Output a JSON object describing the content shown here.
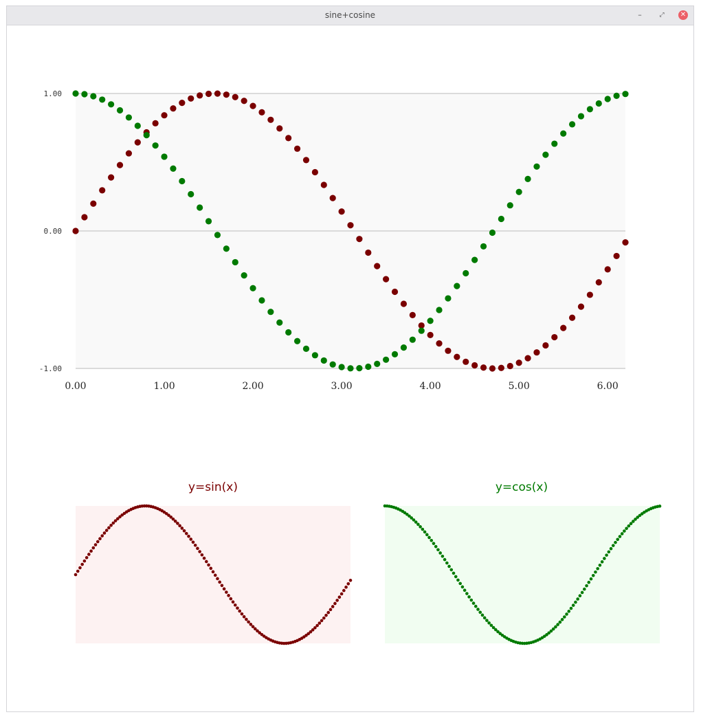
{
  "window": {
    "title": "sine+cosine",
    "buttons": {
      "minimize": "–",
      "restore": "⤢",
      "close": "✕"
    }
  },
  "colors": {
    "sin": "#7a0000",
    "cos": "#007a00",
    "main_bg": "#f9f9f9",
    "sin_bg": "#fdf2f2",
    "cos_bg": "#f1fdf1",
    "grid": "#c8c8c8"
  },
  "chart_data": [
    {
      "type": "scatter",
      "title": "",
      "xlabel": "",
      "ylabel": "",
      "xlim": [
        0,
        6.2
      ],
      "ylim": [
        -1,
        1
      ],
      "x_ticks": [
        "0.00",
        "1.00",
        "2.00",
        "3.00",
        "4.00",
        "5.00",
        "6.00"
      ],
      "y_ticks": [
        "1.00",
        "0.00",
        "-1.00"
      ],
      "grid": "horizontal",
      "series": [
        {
          "function": "sin",
          "x_start": 0,
          "x_step": 0.1,
          "x_end": 6.2
        },
        {
          "function": "cos",
          "x_start": 0,
          "x_step": 0.1,
          "x_end": 6.2
        }
      ]
    },
    {
      "type": "scatter",
      "title": "y=sin(x)",
      "xlim": [
        0,
        6.2
      ],
      "ylim": [
        -1,
        1
      ],
      "series": [
        {
          "function": "sin",
          "x_start": 0,
          "x_step": 0.05,
          "x_end": 6.2
        }
      ]
    },
    {
      "type": "scatter",
      "title": "y=cos(x)",
      "xlim": [
        0,
        6.2
      ],
      "ylim": [
        -1,
        1
      ],
      "series": [
        {
          "function": "cos",
          "x_start": 0,
          "x_step": 0.05,
          "x_end": 6.2
        }
      ]
    }
  ]
}
